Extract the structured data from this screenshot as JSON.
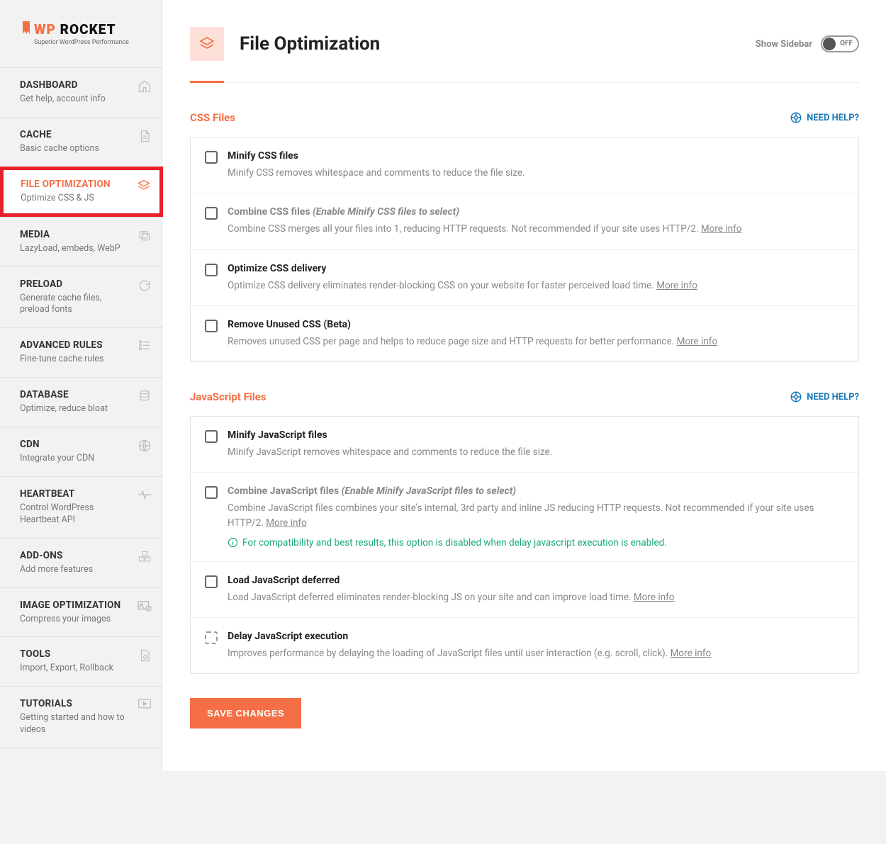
{
  "brand": {
    "wp": "WP",
    "rocket": "ROCKET",
    "tagline": "Superior WordPress Performance"
  },
  "nav": [
    {
      "title": "DASHBOARD",
      "sub": "Get help, account info",
      "icon": "home-icon"
    },
    {
      "title": "CACHE",
      "sub": "Basic cache options",
      "icon": "file-icon"
    },
    {
      "title": "FILE OPTIMIZATION",
      "sub": "Optimize CSS & JS",
      "icon": "layers-icon",
      "active": true
    },
    {
      "title": "MEDIA",
      "sub": "LazyLoad, embeds, WebP",
      "icon": "images-icon"
    },
    {
      "title": "PRELOAD",
      "sub": "Generate cache files, preload fonts",
      "icon": "refresh-icon"
    },
    {
      "title": "ADVANCED RULES",
      "sub": "Fine-tune cache rules",
      "icon": "list-icon"
    },
    {
      "title": "DATABASE",
      "sub": "Optimize, reduce bloat",
      "icon": "database-icon"
    },
    {
      "title": "CDN",
      "sub": "Integrate your CDN",
      "icon": "globe-icon"
    },
    {
      "title": "HEARTBEAT",
      "sub": "Control WordPress Heartbeat API",
      "icon": "heartbeat-icon"
    },
    {
      "title": "ADD-ONS",
      "sub": "Add more features",
      "icon": "cubes-icon"
    },
    {
      "title": "IMAGE OPTIMIZATION",
      "sub": "Compress your images",
      "icon": "image-compress-icon"
    },
    {
      "title": "TOOLS",
      "sub": "Import, Export, Rollback",
      "icon": "gear-file-icon"
    },
    {
      "title": "TUTORIALS",
      "sub": "Getting started and how to videos",
      "icon": "video-icon"
    }
  ],
  "header": {
    "title": "File Optimization",
    "show_sidebar": "Show Sidebar",
    "toggle_state": "OFF"
  },
  "help_label": "NEED HELP?",
  "more_info": "More info",
  "sections": {
    "css": {
      "title": "CSS Files",
      "options": [
        {
          "title": "Minify CSS files",
          "desc": "Minify CSS removes whitespace and comments to reduce the file size."
        },
        {
          "title": "Combine CSS files",
          "hint": "(Enable Minify CSS files to select)",
          "desc": "Combine CSS merges all your files into 1, reducing HTTP requests. Not recommended if your site uses HTTP/2.",
          "more": true,
          "disabled": true
        },
        {
          "title": "Optimize CSS delivery",
          "desc": "Optimize CSS delivery eliminates render-blocking CSS on your website for faster perceived load time.",
          "more": true
        },
        {
          "title": "Remove Unused CSS (Beta)",
          "desc": "Removes unused CSS per page and helps to reduce page size and HTTP requests for better performance.",
          "more": true
        }
      ]
    },
    "js": {
      "title": "JavaScript Files",
      "compat_note": "For compatibility and best results, this option is disabled when delay javascript execution is enabled.",
      "options": [
        {
          "title": "Minify JavaScript files",
          "desc": "Minify JavaScript removes whitespace and comments to reduce the file size."
        },
        {
          "title": "Combine JavaScript files",
          "hint": "(Enable Minify JavaScript files to select)",
          "desc": "Combine JavaScript files combines your site's internal, 3rd party and inline JS reducing HTTP requests. Not recommended if your site uses HTTP/2.",
          "more": true,
          "disabled": true,
          "compat": true
        },
        {
          "title": "Load JavaScript deferred",
          "desc": "Load JavaScript deferred eliminates render-blocking JS on your site and can improve load time.",
          "more": true
        },
        {
          "title": "Delay JavaScript execution",
          "desc": "Improves performance by delaying the loading of JavaScript files until user interaction (e.g. scroll, click).",
          "more": true,
          "dashed": true
        }
      ]
    }
  },
  "save_label": "SAVE CHANGES"
}
